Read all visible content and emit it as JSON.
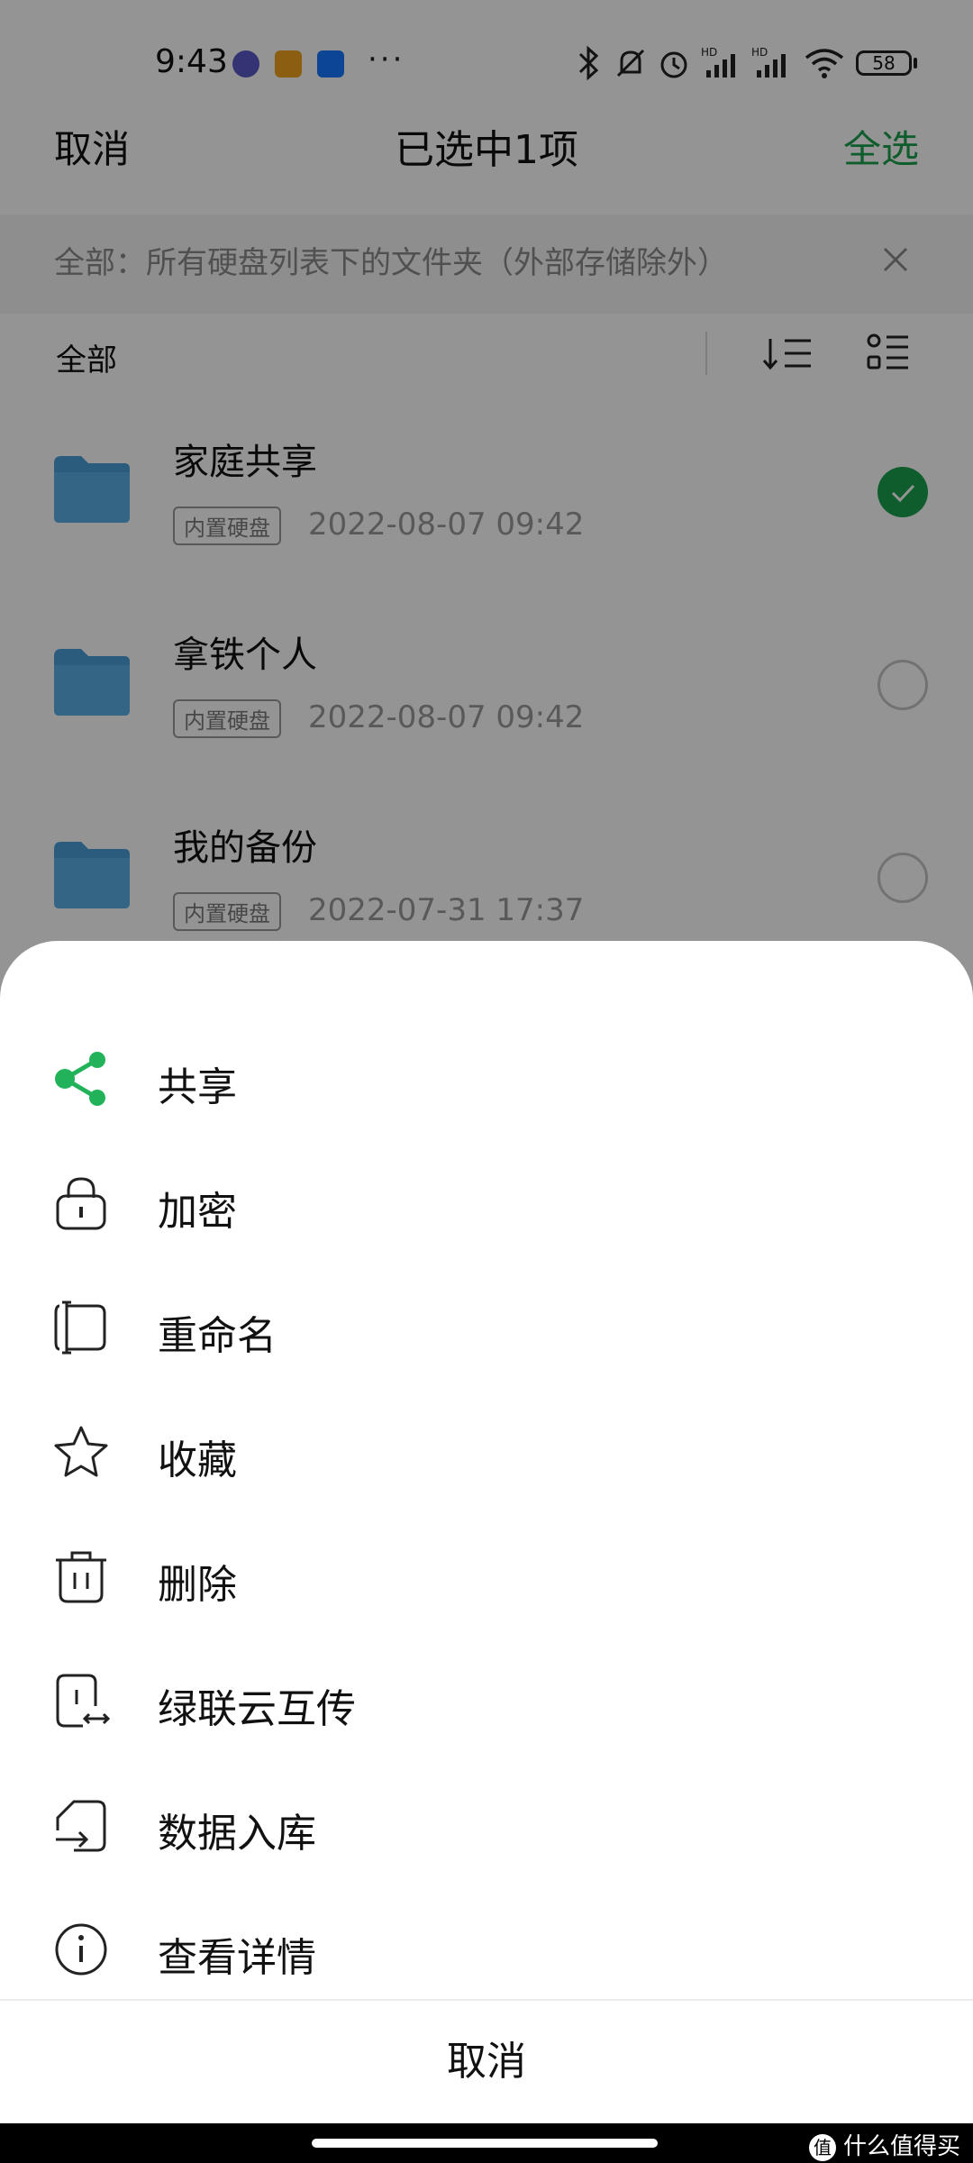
{
  "status_bar": {
    "time": "9:43",
    "battery": "58",
    "more": "···"
  },
  "header": {
    "cancel": "取消",
    "title": "已选中1项",
    "select_all": "全选"
  },
  "filter": {
    "text": "全部：所有硬盘列表下的文件夹（外部存储除外）"
  },
  "toolbar": {
    "label": "全部"
  },
  "files": [
    {
      "name": "家庭共享",
      "tag": "内置硬盘",
      "time": "2022-08-07 09:42",
      "selected": true
    },
    {
      "name": "拿铁个人",
      "tag": "内置硬盘",
      "time": "2022-08-07 09:42",
      "selected": false
    },
    {
      "name": "我的备份",
      "tag": "内置硬盘",
      "time": "2022-07-31 17:37",
      "selected": false
    }
  ],
  "menu": {
    "items": [
      {
        "label": "共享",
        "icon": "share-icon"
      },
      {
        "label": "加密",
        "icon": "lock-icon"
      },
      {
        "label": "重命名",
        "icon": "rename-icon"
      },
      {
        "label": "收藏",
        "icon": "star-icon"
      },
      {
        "label": "删除",
        "icon": "trash-icon"
      },
      {
        "label": "绿联云互传",
        "icon": "phone-transfer-icon"
      },
      {
        "label": "数据入库",
        "icon": "import-icon"
      },
      {
        "label": "查看详情",
        "icon": "info-icon"
      }
    ],
    "cancel": "取消"
  },
  "watermark": {
    "badge": "值",
    "text": "什么值得买"
  },
  "colors": {
    "accent": "#1aa04c",
    "folder": "#4a9fd8"
  }
}
